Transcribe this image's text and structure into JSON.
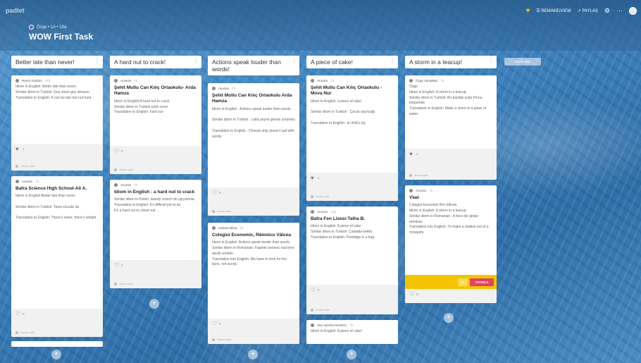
{
  "app": {
    "brand": "padlet"
  },
  "header": {
    "breadcrumb": "Özge • 1A • 19a",
    "title": "WOW First Task",
    "actions": [
      "♥",
      "☰ REMAKE/VIEW",
      "↗ PAYLAŞ",
      "⚙",
      "⋯"
    ]
  },
  "add_section_label": "Bölüm Ekle",
  "columns": [
    {
      "title": "Better late than never!",
      "cards": [
        {
          "author": "Remzi Gürbüz",
          "time": "17d",
          "title": "",
          "body": "Idiom in English: Better late than never.\nSimilar idiom in Turkish: Geç olsun güç olmasın.\nTranslation to English: It can be late but not hard.",
          "heart": "♥",
          "likes": "1",
          "add": "Yorum ekle"
        },
        {
          "author": "Anonim",
          "time": "7h",
          "title": "Bafra Science High School-Ali A.",
          "body": "Idiom in English:Better late than never.\n\nSimilar idiom in Turkish: Tepsi vücudu lar.\n\nTranslation to English: There's some, there's weight.",
          "heart": "♡",
          "likes": "0",
          "add": "Yorum ekle"
        }
      ]
    },
    {
      "title": "A hard nut to crack!",
      "cards": [
        {
          "author": "Anonim",
          "time": "7h",
          "title": "Şehit Mutlu Can Kılıç Ortaokulu- Arda Hamza",
          "body": "Idiom in English:A hard nut to crack\nSimilar idiom in Turkish:çetin ceviz\nTranslation to English: hard nut",
          "heart": "♡",
          "likes": "0",
          "add": "Yorum ekle"
        },
        {
          "author": "Anonim",
          "time": "7h",
          "title": "Idiom in English : a hard nut to crack",
          "body": "Similar idiom in Polish: twardy orzech do zgryzienia\nTranslation to English: It's difficult job to do\nIt's a hard nut to chew/ eat",
          "heart": "♡",
          "likes": "0",
          "add": "Yorum ekle"
        }
      ]
    },
    {
      "title": "Actions speak louder than words!",
      "cards": [
        {
          "author": "Anonim",
          "time": "7h",
          "title": "Şehit Mutlu Can Kılıç Ortaokulu Arda Hamza",
          "body": "Idiom in English : Actions speak louder than words.\n\nSimilar idiom in Turkish : Lafla peynir gemisi yürümez\n\nTranslation to English : Cheese ship doesn't sail with words",
          "heart": "♡",
          "likes": "0",
          "add": "Yorum ekle"
        },
        {
          "author": "Hatiora Mihai",
          "time": "7h",
          "title": "Colegiul Economic, Râmnicu Vâlcea",
          "body": "Idiom in English: Actions speak louder than words.\nSimilar idiom in Romanian: Faptele vorbesc mai bine decât vorbele\nTranslation into English: We have to look for the facts, not words.",
          "heart": "♡",
          "likes": "0",
          "add": "Yorum ekle"
        }
      ]
    },
    {
      "title": "A piece of cake!",
      "cards": [
        {
          "author": "Anonim",
          "time": "7h",
          "title": "Şehit Mutlu Can Kılıç Ortaokulu - Mova Nur",
          "body": "Idiom in English: a piece of cake.\n\nSimilar idiom in Turkish : Çocuk oyuncağı\n\nTranslation to English : A child's toy",
          "heart": "♥",
          "likes": "1",
          "add": "Yorum ekle"
        },
        {
          "author": "Anonim",
          "time": "14d",
          "title": "Bafra Fen Lisesi-Talha B.",
          "body": "Idiom in English: A piece of cake\nSimilar idiom in Turkish: Çantada keklik\nTranslation to English: Partridge in a bag",
          "heart": "♡",
          "likes": "0",
          "add": "Yorum ekle"
        },
        {
          "author": "ANA-MARIA MARCU",
          "time": "7h",
          "title": "",
          "body": "Idiom in English: A piece of cake!",
          "heart": "",
          "likes": "",
          "add": ""
        }
      ]
    },
    {
      "title": "A storm in a teacup!",
      "cards": [
        {
          "author": "Özge Abutalkan",
          "time": "7h",
          "title": "",
          "body": "Özge\nIdiom in English: A storm in a teacup.\nSimilar idiom in Turkish: Bir bardak suda fırtına koparmak\nTranslation to English: Make a storm in a glass of water.",
          "heart": "♥",
          "likes": "1",
          "add": "Yorum ekle"
        },
        {
          "author": "Anonim",
          "time": "7h",
          "title": "Vlad",
          "body": "Colegiul Economic Rm.Vâlcea\nIdiom in English: A storm in a teacup.\nSimilar idiom in Romanian : A face din ţânţar armăsar.\nTranslation into English: To make a stallion out of a mosquito.",
          "heart": "♡",
          "likes": "0",
          "add": "",
          "skip": "Gİ",
          "publish": "YAYINLA"
        }
      ]
    }
  ],
  "plus_label": "+"
}
